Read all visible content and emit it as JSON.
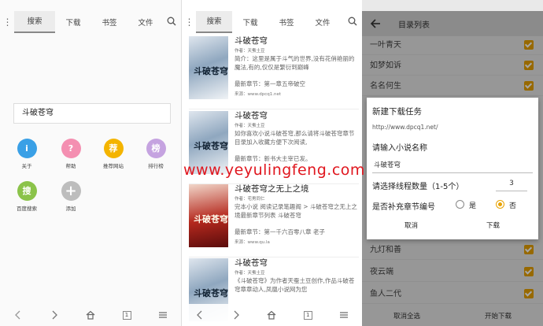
{
  "panel1": {
    "tabs": [
      "搜索",
      "下载",
      "书签",
      "文件"
    ],
    "search_value": "斗破苍穹",
    "shortcuts": [
      {
        "label": "关于",
        "glyph": "i",
        "color": "#3aa0e6"
      },
      {
        "label": "帮助",
        "glyph": "?",
        "color": "#f48fb1"
      },
      {
        "label": "推荐网站",
        "glyph": "荐",
        "color": "#f4b400"
      },
      {
        "label": "排行榜",
        "glyph": "榜",
        "color": "#c5a3e0"
      },
      {
        "label": "百度搜索",
        "glyph": "搜",
        "color": "#8bc34a"
      },
      {
        "label": "添加",
        "glyph": "+",
        "color": "#bdbdbd"
      }
    ],
    "nav_tab_count": "1"
  },
  "panel2": {
    "tabs": [
      "搜索",
      "下载",
      "书签",
      "文件"
    ],
    "results": [
      {
        "title": "斗破苍穹",
        "author": "作者：天蚕土豆",
        "desc": "简介：这里是属于斗气的世界,没有花俏艳丽的魔法,有的,仅仅是繁衍到巅峰",
        "latest": "最新章节：第一章五帝破空",
        "source": "来源：www.dpcq1.net",
        "cover_text": "斗破苍穹"
      },
      {
        "title": "斗破苍穹",
        "author": "作者：天蚕土豆",
        "desc": "如你喜欢小说斗破苍穹,那么请将斗破苍穹章节目录加入收藏方便下次阅读,",
        "latest": "最新章节：新书大主宰已发。",
        "source": "",
        "cover_text": "斗破苍穹"
      },
      {
        "title": "斗破苍穹之无上之境",
        "author": "作者：宅男同仁",
        "desc": "完本小说 阅读记录笔趣阁 > 斗破苍穹之无上之境最新章节列表 斗破苍穹",
        "latest": "最新章节：第一千六百零八章 老子",
        "source": "来源：www.qu.la",
        "cover_text": "斗破苍穹"
      },
      {
        "title": "斗破苍穹",
        "author": "作者：天蚕土豆",
        "desc": "《斗破苍穹》为作者天蚕土豆创作,作品斗破苍穹章章动人,凤凰小说网为您",
        "latest": "",
        "source": "",
        "cover_text": "斗破苍穹"
      }
    ]
  },
  "panel3": {
    "title": "目录列表",
    "chapters_top": [
      "一叶青天",
      "如梦如诉",
      "名名何生"
    ],
    "chapters_bottom": [
      "九灯和善",
      "夜云端",
      "鱼人二代"
    ],
    "bottom_left": "取消全选",
    "bottom_right": "开始下载",
    "dialog": {
      "title": "新建下载任务",
      "url": "http://www.dpcq1.net/",
      "name_label": "请输入小说名称",
      "name_value": "斗破苍穹",
      "thread_label": "请选择线程数量（1-5个）",
      "thread_value": "3",
      "pad_label": "是否补充章节编号",
      "yes": "是",
      "no": "否",
      "cancel": "取消",
      "download": "下载"
    }
  },
  "watermark": "www.yeyulingfeng.com"
}
